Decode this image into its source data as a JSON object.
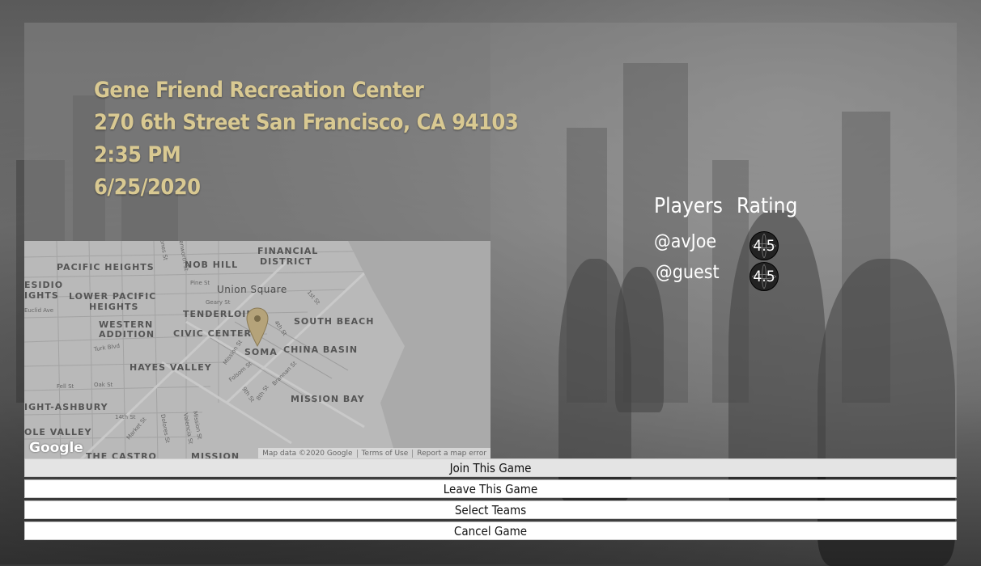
{
  "game": {
    "location": "Gene Friend Recreation Center",
    "address": "270 6th Street San Francisco, CA 94103",
    "time": "2:35 PM",
    "date": "6/25/2020"
  },
  "map": {
    "neighborhoods": [
      "PACIFIC HEIGHTS",
      "NOB HILL",
      "FINANCIAL",
      "DISTRICT",
      "ESIDIO",
      "IGHTS",
      "LOWER PACIFIC",
      "HEIGHTS",
      "Union Square",
      "TENDERLOIN",
      "SOUTH BEACH",
      "WESTERN",
      "ADDITION",
      "CIVIC CENTER",
      "SOMA",
      "CHINA BASIN",
      "HAYES VALLEY",
      "MISSION BAY",
      "IGHT-ASHBURY",
      "OLE VALLEY",
      "THE CASTRO",
      "MISSION"
    ],
    "streets": [
      "Pine St",
      "Geary St",
      "1st St",
      "4th St",
      "Turk Blvd",
      "Mission St",
      "Folsom St",
      "Brannan St",
      "Fell St",
      "Oak St",
      "9th St",
      "8th St",
      "14th St",
      "Market St",
      "Dolores St",
      "Valencia St",
      "Mission St",
      "Euclid Ave",
      "Jones St",
      "Leavenworth St"
    ],
    "logo": "Google",
    "attribution": [
      "Map data ©2020 Google",
      "Terms of Use",
      "Report a map error"
    ]
  },
  "players_table": {
    "headers": {
      "players": "Players",
      "rating": "Rating"
    },
    "rows": [
      {
        "name": "@avJoe",
        "rating": "4.5"
      },
      {
        "name": "@guest",
        "rating": "4.5"
      }
    ]
  },
  "actions": {
    "join": "Join This Game",
    "leave": "Leave This Game",
    "select_teams": "Select Teams",
    "cancel": "Cancel Game"
  },
  "colors": {
    "title_gold": "#d9c992",
    "text_white": "#ffffff",
    "button_bg": "#ffffff"
  },
  "icons": {
    "pin": "map-pin-icon",
    "rating": "basketball-icon"
  }
}
